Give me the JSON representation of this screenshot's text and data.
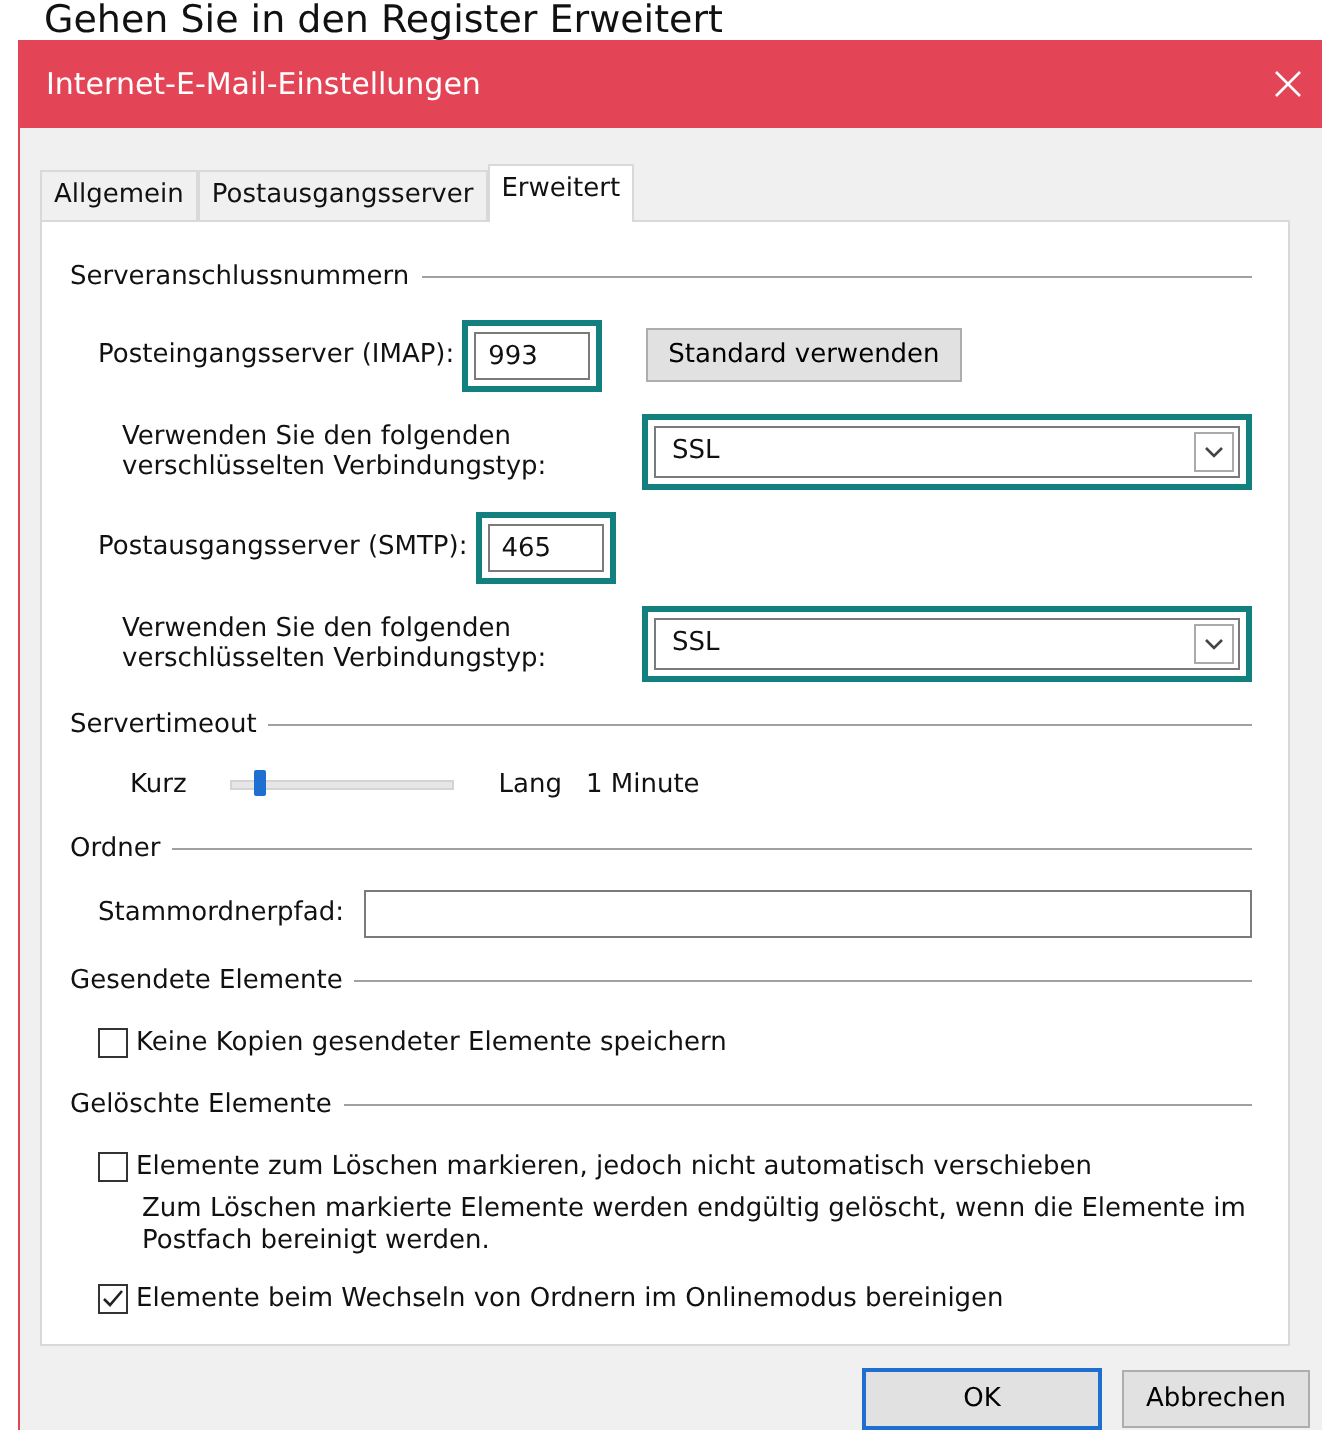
{
  "caption": "Gehen Sie in den Register Erweitert",
  "window": {
    "title": "Internet-E-Mail-Einstellungen"
  },
  "tabs": [
    {
      "label": "Allgemein",
      "selected": false
    },
    {
      "label": "Postausgangsserver",
      "selected": false
    },
    {
      "label": "Erweitert",
      "selected": true
    }
  ],
  "server_ports": {
    "title": "Serveranschlussnummern",
    "incoming": {
      "label": "Posteingangsserver (IMAP):",
      "value": "993",
      "highlighted": true
    },
    "default_button": "Standard verwenden",
    "incoming_encryption": {
      "label": "Verwenden Sie den folgenden verschlüsselten Verbindungstyp:",
      "value": "SSL",
      "highlighted": true
    },
    "outgoing": {
      "label": "Postausgangsserver (SMTP):",
      "value": "465",
      "highlighted": true
    },
    "outgoing_encryption": {
      "label": "Verwenden Sie den folgenden verschlüsselten Verbindungstyp:",
      "value": "SSL",
      "highlighted": true
    }
  },
  "server_timeout": {
    "title": "Servertimeout",
    "min_label": "Kurz",
    "max_label": "Lang",
    "level": 0.1,
    "reading": "1 Minute"
  },
  "folders": {
    "title": "Ordner",
    "root_label": "Stammordnerpfad:"
  },
  "sent_items": {
    "title": "Gesendete Elemente",
    "options": [
      {
        "kind": "checkbox",
        "label": "Keine Kopien gesendeter Elemente speichern",
        "checked": false
      }
    ]
  },
  "deleted_items": {
    "title": "Gelöschte Elemente",
    "options": [
      {
        "kind": "checkbox",
        "label": "Elemente zum Löschen markieren, jedoch nicht automatisch verschieben",
        "checked": false
      },
      {
        "kind": "note",
        "label": "Zum Löschen markierte Elemente werden endgültig gelöscht, wenn die Elemente im Postfach bereinigt werden."
      },
      {
        "kind": "checkbox",
        "label": "Elemente beim Wechseln von Ordnern im Onlinemodus bereinigen",
        "checked": true
      }
    ]
  },
  "buttons": [
    {
      "label": "OK",
      "default": true
    },
    {
      "label": "Abbrechen",
      "default": false
    }
  ]
}
